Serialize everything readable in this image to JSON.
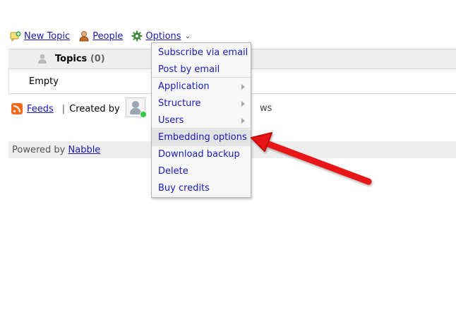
{
  "toolbar": {
    "new_topic": "New Topic",
    "people": "People",
    "options": "Options"
  },
  "topics": {
    "title": "Topics",
    "count": "(0)",
    "empty": "Empty"
  },
  "feeds_row": {
    "feeds": "Feeds",
    "separator": "|",
    "created_by": "Created by",
    "trailing": "ws"
  },
  "footer": {
    "powered_by": "Powered by",
    "brand": "Nabble"
  },
  "menu": {
    "items": [
      {
        "label": "Subscribe via email",
        "submenu": false
      },
      {
        "label": "Post by email",
        "submenu": false
      },
      {
        "label": "Application",
        "submenu": true
      },
      {
        "label": "Structure",
        "submenu": true
      },
      {
        "label": "Users",
        "submenu": true
      },
      {
        "label": "Embedding options",
        "submenu": false,
        "highlighted": true
      },
      {
        "label": "Download backup",
        "submenu": false
      },
      {
        "label": "Delete",
        "submenu": false
      },
      {
        "label": "Buy credits",
        "submenu": false
      }
    ]
  },
  "icons": {
    "new_topic": "new-topic-icon",
    "people": "person-icon",
    "options": "gear-icon",
    "feeds": "rss-icon",
    "annotation": "red-arrow"
  },
  "colors": {
    "link": "#1a1ab4",
    "header_bg": "#eeeeee",
    "highlight": "#e3e3e3",
    "arrow": "#e81515"
  }
}
